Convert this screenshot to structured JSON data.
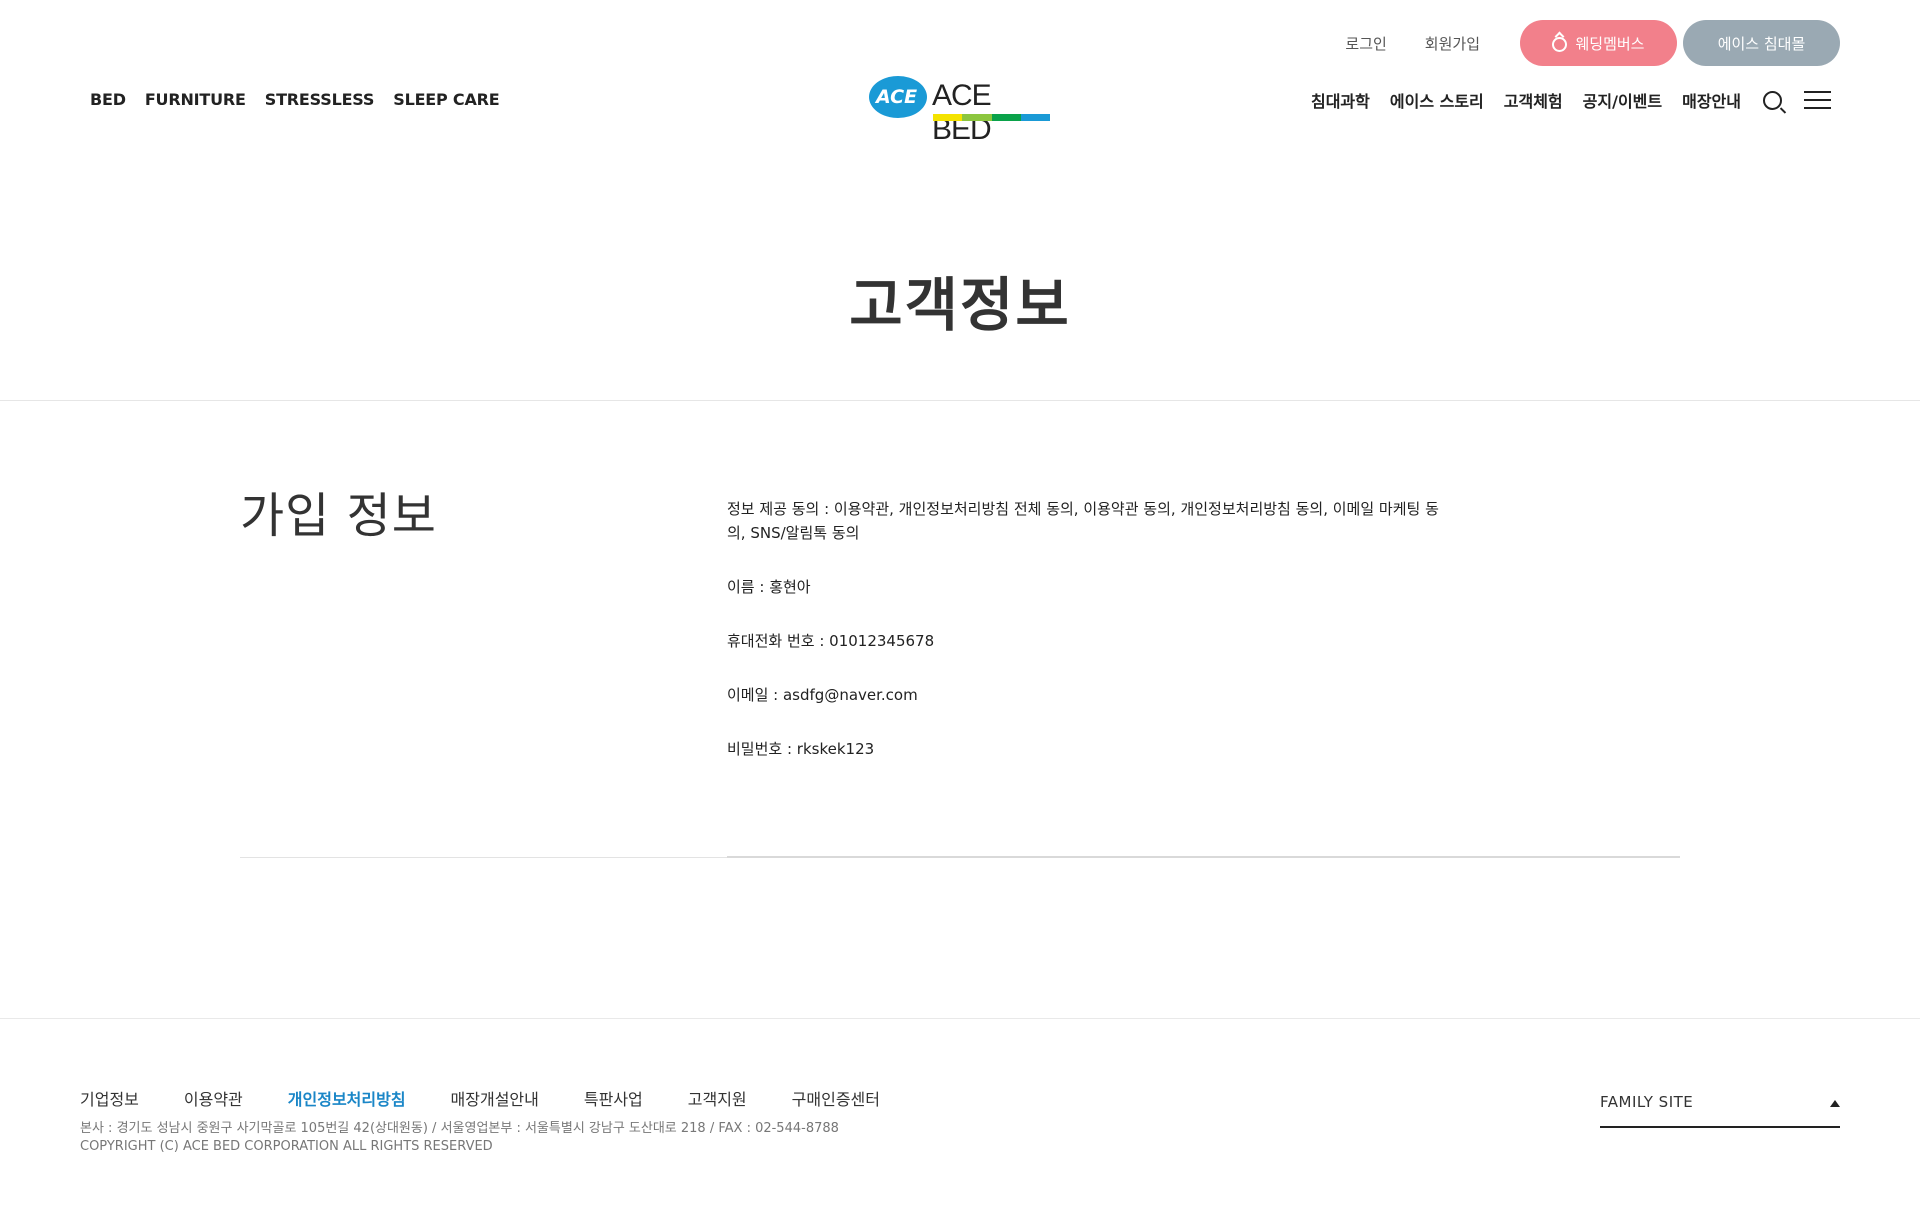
{
  "header": {
    "util": {
      "login": "로그인",
      "signup": "회원가입",
      "wedding": "웨딩멤버스",
      "mall": "에이스 침대몰"
    },
    "left_nav": [
      "BED",
      "FURNITURE",
      "STRESSLESS",
      "SLEEP CARE"
    ],
    "logo": {
      "mark": "ACE",
      "text": "ACE BED",
      "bar_colors": [
        "#f4e300",
        "#8cc63e",
        "#0aa24a",
        "#1a9ad6"
      ]
    },
    "right_nav": [
      "침대과학",
      "에이스 스토리",
      "고객체험",
      "공지/이벤트",
      "매장안내"
    ]
  },
  "page": {
    "title": "고객정보"
  },
  "content": {
    "section_title": "가입 정보",
    "consent": "정보 제공 동의 : 이용약관, 개인정보처리방침 전체 동의, 이용약관 동의, 개인정보처리방침 동의, 이메일 마케팅 동의, SNS/알림톡 동의",
    "name": "이름 : 홍현아",
    "phone": "휴대전화 번호 : 01012345678",
    "email": "이메일 : asdfg@naver.com",
    "password": "비밀번호 : rkskek123"
  },
  "footer": {
    "nav": [
      "기업정보",
      "이용약관",
      "개인정보처리방침",
      "매장개설안내",
      "특판사업",
      "고객지원",
      "구매인증센터"
    ],
    "active_index": 2,
    "address": "본사 : 경기도 성남시 중원구 사기막골로 105번길 42(상대원동) / 서울영업본부 : 서울특별시 강남구 도산대로 218 / FAX : 02-544-8788",
    "copyright": "COPYRIGHT (C) ACE BED CORPORATION ALL RIGHTS RESERVED",
    "family_site": "FAMILY SITE"
  },
  "colors": {
    "wedding_pill": "#f2808b",
    "mall_pill": "#9aa9b3",
    "active_link": "#1a86c7"
  }
}
